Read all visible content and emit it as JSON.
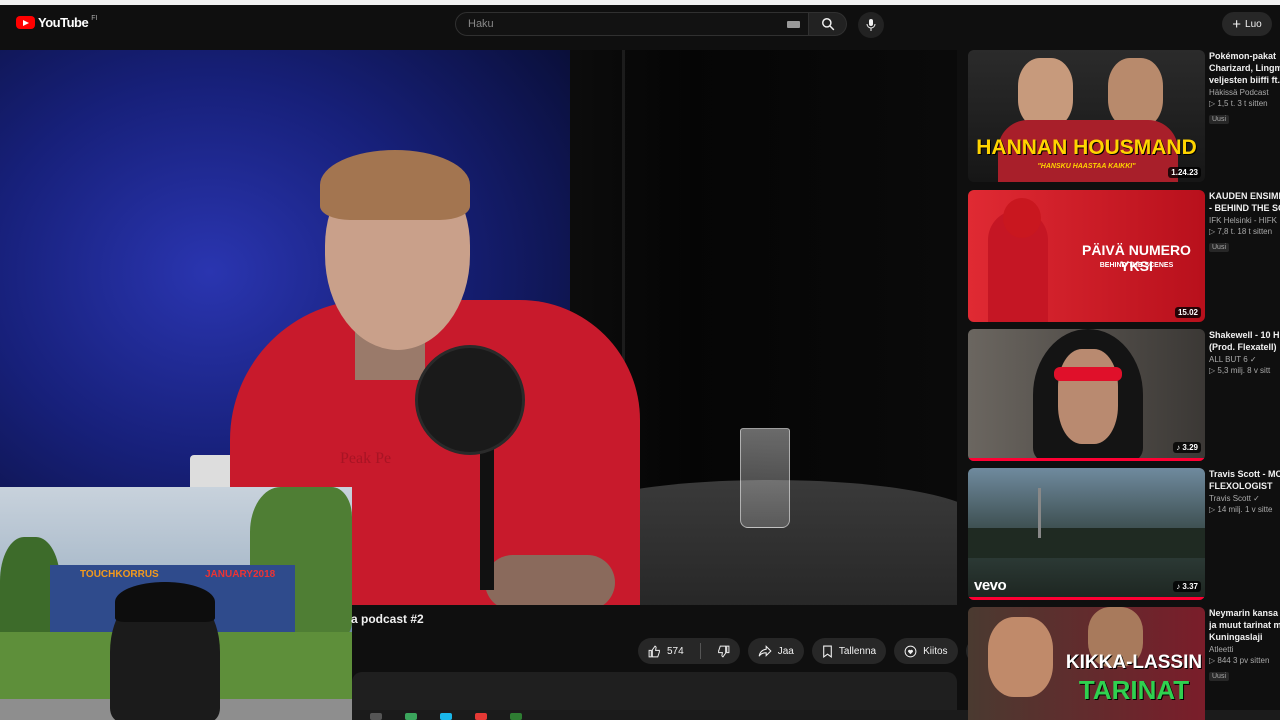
{
  "header": {
    "logo_text": "YouTube",
    "country_code": "FI",
    "search_placeholder": "Haku",
    "create_label": "Luo"
  },
  "video": {
    "title_fragment": "a podcast #2",
    "hoodie_print": "Peak Pe",
    "actions": {
      "like_count": "574",
      "share_label": "Jaa",
      "save_label": "Tallenna",
      "thanks_label": "Kiitos"
    }
  },
  "webcam": {
    "graffiti_left": "TOUCHKORRUS",
    "graffiti_right": "JANUARY2018"
  },
  "recommendations": [
    {
      "title_lines": [
        "Pokémon-pakat",
        "Charizard, Lingm",
        "veljesten biiffi ft."
      ],
      "channel": "Häkissä Podcast",
      "stats": "▷ 1,5 t.   3 t sitten",
      "badge": "Uusi",
      "duration": "1.24.23",
      "thumb_text": "HANNAN HOUSMAND",
      "thumb_sub": "\"HANSKU HAASTAA KAIKKI\"",
      "progress": 0
    },
    {
      "title_lines": [
        "KAUDEN ENSIMM",
        "- BEHIND THE SC"
      ],
      "channel": "IFK Helsinki - HIFK",
      "stats": "▷ 7,8 t.   18 t sitten",
      "badge": "Uusi",
      "duration": "15.02",
      "thumb_text": "PÄIVÄ NUMERO YKSI",
      "thumb_sub": "BEHIND THE SCENES",
      "progress": 0
    },
    {
      "title_lines": [
        "Shakewell - 10 H",
        "(Prod. Flexatell)"
      ],
      "channel": "ALL BUT 6 ✓",
      "stats": "▷ 5,3 milj.   8 v sitt",
      "badge": "",
      "duration": "♪ 3.29",
      "thumb_text": "",
      "thumb_sub": "",
      "progress": 1.0
    },
    {
      "title_lines": [
        "Travis Scott - MC",
        "FLEXOLOGIST"
      ],
      "channel": "Travis Scott ✓",
      "stats": "▷ 14 milj.   1 v sitte",
      "badge": "",
      "duration": "♪ 3.37",
      "thumb_text": "vevo",
      "thumb_sub": "",
      "progress": 1.0
    },
    {
      "title_lines": [
        "Neymarin kansa",
        "ja muut tarinat m",
        "Kuningaslaji"
      ],
      "channel": "Atleetti",
      "stats": "▷ 844   3 pv sitten",
      "badge": "Uusi",
      "duration": "",
      "thumb_text": "KIKKA-LASSIN",
      "thumb_sub": "TARINAT",
      "progress": 0
    }
  ],
  "colors": {
    "brand_red": "#ff0000",
    "progress_red": "#ff0033",
    "background": "#0f0f0f"
  }
}
